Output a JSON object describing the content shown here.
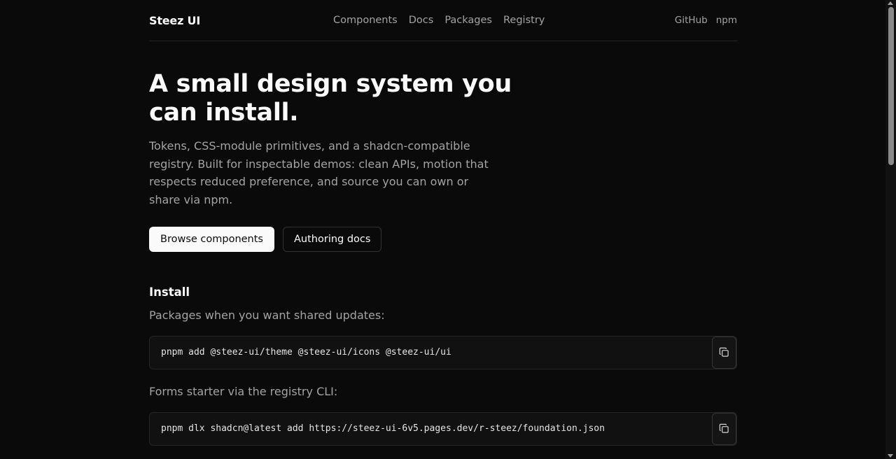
{
  "header": {
    "brand": "Steez UI",
    "nav": [
      "Components",
      "Docs",
      "Packages",
      "Registry"
    ],
    "external": [
      "GitHub",
      "npm"
    ]
  },
  "hero": {
    "title": "A small design system you can install.",
    "subtitle": "Tokens, CSS-module primitives, and a shadcn-compatible registry. Built for inspectable demos: clean APIs, motion that respects reduced preference, and source you can own or share via npm.",
    "primary_cta": "Browse components",
    "secondary_cta": "Authoring docs"
  },
  "install": {
    "title": "Install",
    "packages_desc": "Packages when you want shared updates:",
    "packages_cmd": "pnpm add @steez-ui/theme @steez-ui/icons @steez-ui/ui",
    "registry_desc": "Forms starter via the registry CLI:",
    "registry_cmd": "pnpm dlx shadcn@latest add https://steez-ui-6v5.pages.dev/r-steez/foundation.json"
  },
  "icons": {
    "copy": "copy-icon"
  }
}
